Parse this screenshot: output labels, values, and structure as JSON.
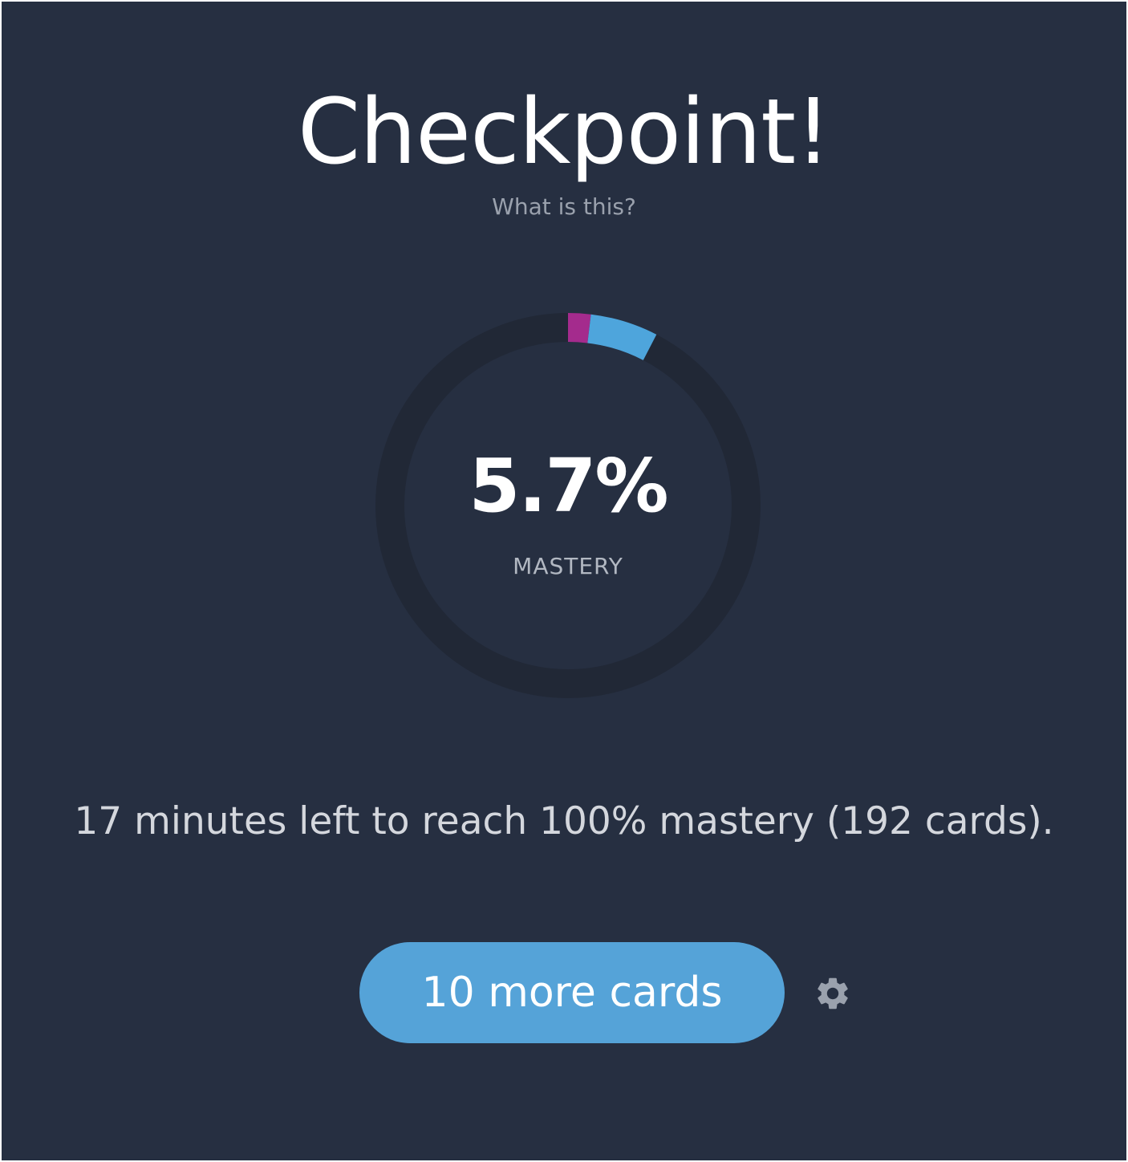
{
  "checkpoint": {
    "title": "Checkpoint!",
    "help_link": "What is this?"
  },
  "mastery": {
    "percent_text": "5.7%",
    "label": "MASTERY",
    "segments": [
      {
        "name": "magenta",
        "fraction": 0.019,
        "color": "#a42b8d"
      },
      {
        "name": "blue",
        "fraction": 0.057,
        "color": "#4ea5dc"
      }
    ],
    "track_color": "#212836"
  },
  "status_text": "17 minutes left to reach 100% mastery (192 cards).",
  "actions": {
    "more_cards_label": "10 more cards",
    "settings_icon": "gear-icon"
  },
  "colors": {
    "background": "#262f41",
    "button": "#55a3d8"
  }
}
